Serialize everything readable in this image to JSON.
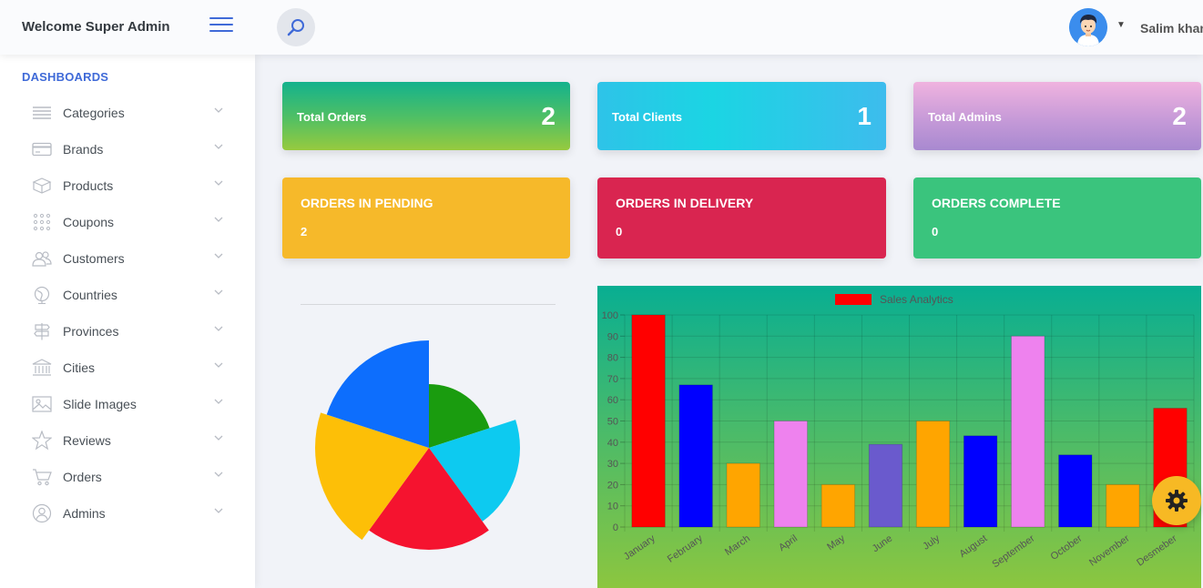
{
  "header": {
    "title": "Welcome Super Admin",
    "user_name": "Salim khan"
  },
  "sidebar": {
    "heading": "DASHBOARDS",
    "items": [
      {
        "label": "Categories",
        "icon": "list-icon"
      },
      {
        "label": "Brands",
        "icon": "credit-card-icon"
      },
      {
        "label": "Products",
        "icon": "box-icon"
      },
      {
        "label": "Coupons",
        "icon": "grid-dots-icon"
      },
      {
        "label": "Customers",
        "icon": "users-icon"
      },
      {
        "label": "Countries",
        "icon": "globe-icon"
      },
      {
        "label": "Provinces",
        "icon": "signpost-icon"
      },
      {
        "label": "Cities",
        "icon": "building-icon"
      },
      {
        "label": "Slide Images",
        "icon": "image-icon"
      },
      {
        "label": "Reviews",
        "icon": "star-icon"
      },
      {
        "label": "Orders",
        "icon": "cart-icon"
      },
      {
        "label": "Admins",
        "icon": "user-circle-icon"
      }
    ]
  },
  "stats": {
    "total_orders": {
      "label": "Total Orders",
      "value": "2"
    },
    "total_clients": {
      "label": "Total Clients",
      "value": "1"
    },
    "total_admins": {
      "label": "Total Admins",
      "value": "2"
    }
  },
  "status_cards": {
    "pending": {
      "label": "ORDERS IN PENDING",
      "value": "2"
    },
    "delivery": {
      "label": "ORDERS IN DELIVERY",
      "value": "0"
    },
    "complete": {
      "label": "ORDERS COMPLETE",
      "value": "0"
    }
  },
  "colors": {
    "accent": "#3f6ad8",
    "pending": "#f6b92a",
    "delivery": "#d92550",
    "complete": "#3ac47d"
  },
  "chart_data": [
    {
      "type": "pie",
      "variant": "polar-area",
      "segments": [
        {
          "color": "#1a9c0f",
          "value": 70
        },
        {
          "color": "#0dcaf0",
          "value": 100
        },
        {
          "color": "#f5132f",
          "value": 112
        },
        {
          "color": "#fdbf07",
          "value": 125
        },
        {
          "color": "#0d6efd",
          "value": 118
        }
      ]
    },
    {
      "type": "bar",
      "legend": [
        "Sales Analytics"
      ],
      "legend_position": "top",
      "grid": true,
      "categories": [
        "January",
        "February",
        "March",
        "April",
        "May",
        "June",
        "July",
        "August",
        "September",
        "October",
        "November",
        "Desmeber"
      ],
      "series": [
        {
          "name": "Sales Analytics",
          "values": [
            100,
            67,
            30,
            50,
            20,
            39,
            50,
            43,
            90,
            34,
            20,
            56
          ],
          "colors": [
            "#ff0000",
            "#0000ff",
            "#ffa500",
            "#ee82ee",
            "#ffa500",
            "#6a5acd",
            "#ffa500",
            "#0000ff",
            "#ee82ee",
            "#0000ff",
            "#ffa500",
            "#ff0000"
          ]
        }
      ],
      "ylim": [
        0,
        100
      ],
      "yticks": [
        "0",
        "10",
        "20",
        "30",
        "40",
        "50",
        "60",
        "70",
        "80",
        "90",
        "100"
      ]
    }
  ]
}
